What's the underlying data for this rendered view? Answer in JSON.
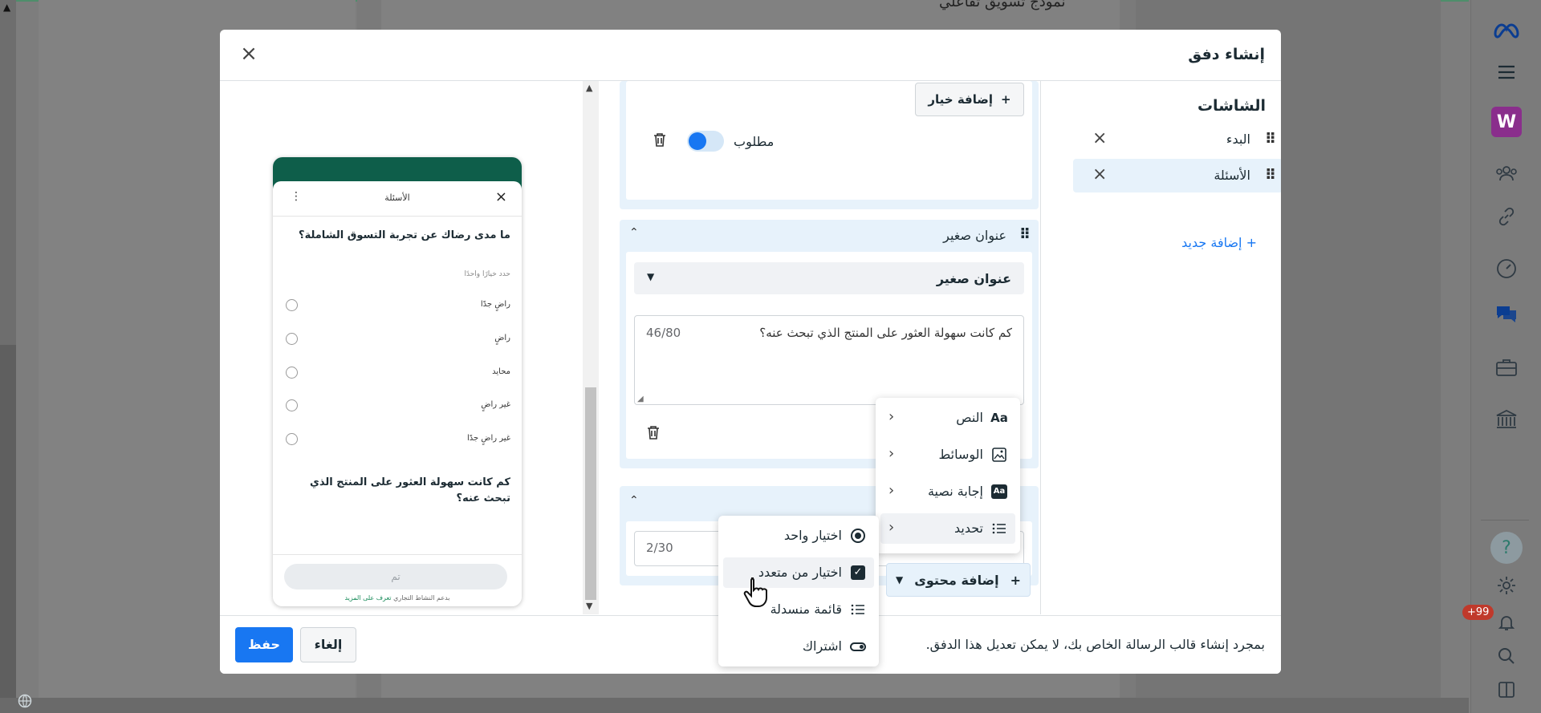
{
  "background": {
    "heading": "نموذج تسويق تفاعلي"
  },
  "rail": {
    "items": [
      "meta-logo",
      "menu-icon",
      "workspace-w",
      "people-icon",
      "link-icon",
      "gauge-icon",
      "chat-icon",
      "briefcase-icon",
      "bank-icon",
      "help-icon",
      "settings-icon",
      "bell-icon",
      "search-icon",
      "sidebar-icon"
    ],
    "workspace_letter": "W",
    "help_glyph": "?",
    "notification_badge": "+99"
  },
  "modal": {
    "title": "إنشاء دفق",
    "close_glyph": "×"
  },
  "screens": {
    "title": "الشاشات",
    "items": [
      {
        "label": "البدء",
        "active": false
      },
      {
        "label": "الأسئلة",
        "active": true
      }
    ],
    "add_new": "+ إضافة جديد"
  },
  "editor": {
    "add_option": "إضافة خيار",
    "required_label": "مطلوب",
    "subheading_card_title": "عنوان صغير",
    "subheading_select_value": "عنوان صغير",
    "subheading_text": "كم كانت سهولة العثور على المنتج الذي تبحث عنه؟",
    "subheading_counter": "46/80",
    "third_card_counter": "2/30",
    "add_content": "إضافة محتوى"
  },
  "content_menu": {
    "items": [
      {
        "label": "النص",
        "icon": "text-aa-icon"
      },
      {
        "label": "الوسائط",
        "icon": "image-icon"
      },
      {
        "label": "إجابة نصية",
        "icon": "text-answer-icon"
      },
      {
        "label": "تحديد",
        "icon": "list-icon",
        "highlighted": true
      }
    ],
    "icon_glyphs": {
      "text": "Aa",
      "answer": "Aa"
    }
  },
  "selection_menu": {
    "items": [
      {
        "label": "اختيار واحد",
        "icon": "radio-icon"
      },
      {
        "label": "اختيار من متعدد",
        "icon": "checkbox-icon",
        "highlighted": true
      },
      {
        "label": "قائمة منسدلة",
        "icon": "dropdown-list-icon"
      },
      {
        "label": "اشتراك",
        "icon": "opt-in-toggle-icon"
      }
    ]
  },
  "preview": {
    "sheet_title": "الأسئلة",
    "question1": "ما مدى رضاك عن تجربة التسوق الشاملة؟",
    "hint": "حدد خيارًا واحدًا",
    "options": [
      "راضٍ جدًا",
      "راضٍ",
      "محايد",
      "غير راضٍ",
      "غير راضٍ جدًا"
    ],
    "question2": "كم كانت سهولة العثور على المنتج الذي تبحث عنه؟",
    "done_button": "تم",
    "footer_text": "بدعم النشاط التجاري",
    "footer_link": "تعرف على المزيد"
  },
  "footer": {
    "note": "بمجرد إنشاء قالب الرسالة الخاص بك، لا يمكن تعديل هذا الدفق.",
    "cancel": "إلغاء",
    "save": "حفظ"
  },
  "colors": {
    "primary": "#1877f2",
    "card_bg": "#e7f2fb",
    "whatsapp_green": "#0e5e4a",
    "badge_red": "#c0392b"
  }
}
